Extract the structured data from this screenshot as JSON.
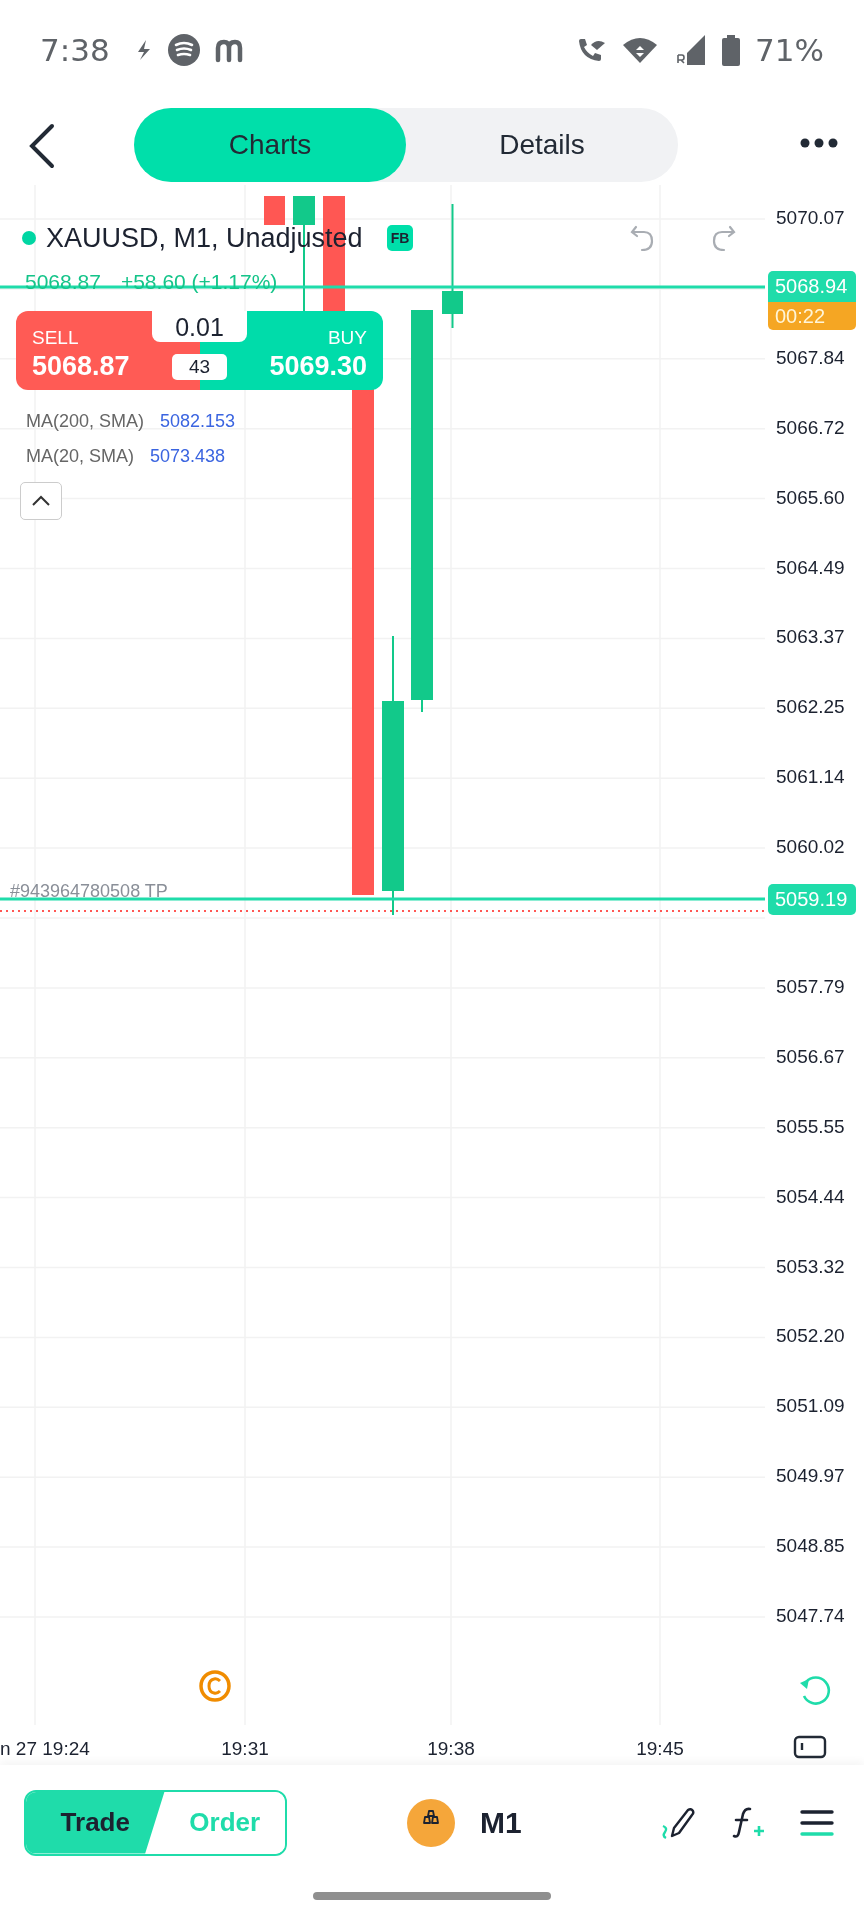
{
  "status_bar": {
    "time": "7:38",
    "battery": "71%"
  },
  "header": {
    "tabs": [
      {
        "label": "Charts",
        "selected": true
      },
      {
        "label": "Details",
        "selected": false
      }
    ]
  },
  "chart": {
    "symbol": "XAUUSD, M1, Unadjusted",
    "badge": "FB",
    "last_price": "5068.87",
    "change": "+58.60 (+1.17%)",
    "trade_panel": {
      "sell_label": "SELL",
      "sell_price": "5068.87",
      "buy_label": "BUY",
      "buy_price": "5069.30",
      "volume": "0.01",
      "spread": "43"
    },
    "indicators": [
      {
        "name": "MA(200, SMA)",
        "value": "5082.153"
      },
      {
        "name": "MA(20, SMA)",
        "value": "5073.438"
      }
    ],
    "order_line": {
      "label": "#943964780508 TP"
    },
    "price_axis": [
      "5070.07",
      "5067.84",
      "5066.72",
      "5065.60",
      "5064.49",
      "5063.37",
      "5062.25",
      "5061.14",
      "5060.02",
      "5057.79",
      "5056.67",
      "5055.55",
      "5054.44",
      "5053.32",
      "5052.20",
      "5051.09",
      "5049.97",
      "5048.85",
      "5047.74"
    ],
    "price_tags": [
      {
        "kind": "price",
        "value": "5068.94",
        "timer": "00:22"
      },
      {
        "kind": "order",
        "value": "5059.19"
      }
    ],
    "time_axis": [
      "n 27 19:24",
      "19:31",
      "19:38",
      "19:45"
    ]
  },
  "bottom_bar": {
    "modes": [
      {
        "label": "Trade",
        "selected": true
      },
      {
        "label": "Order",
        "selected": false
      }
    ],
    "timeframe": "M1"
  }
}
